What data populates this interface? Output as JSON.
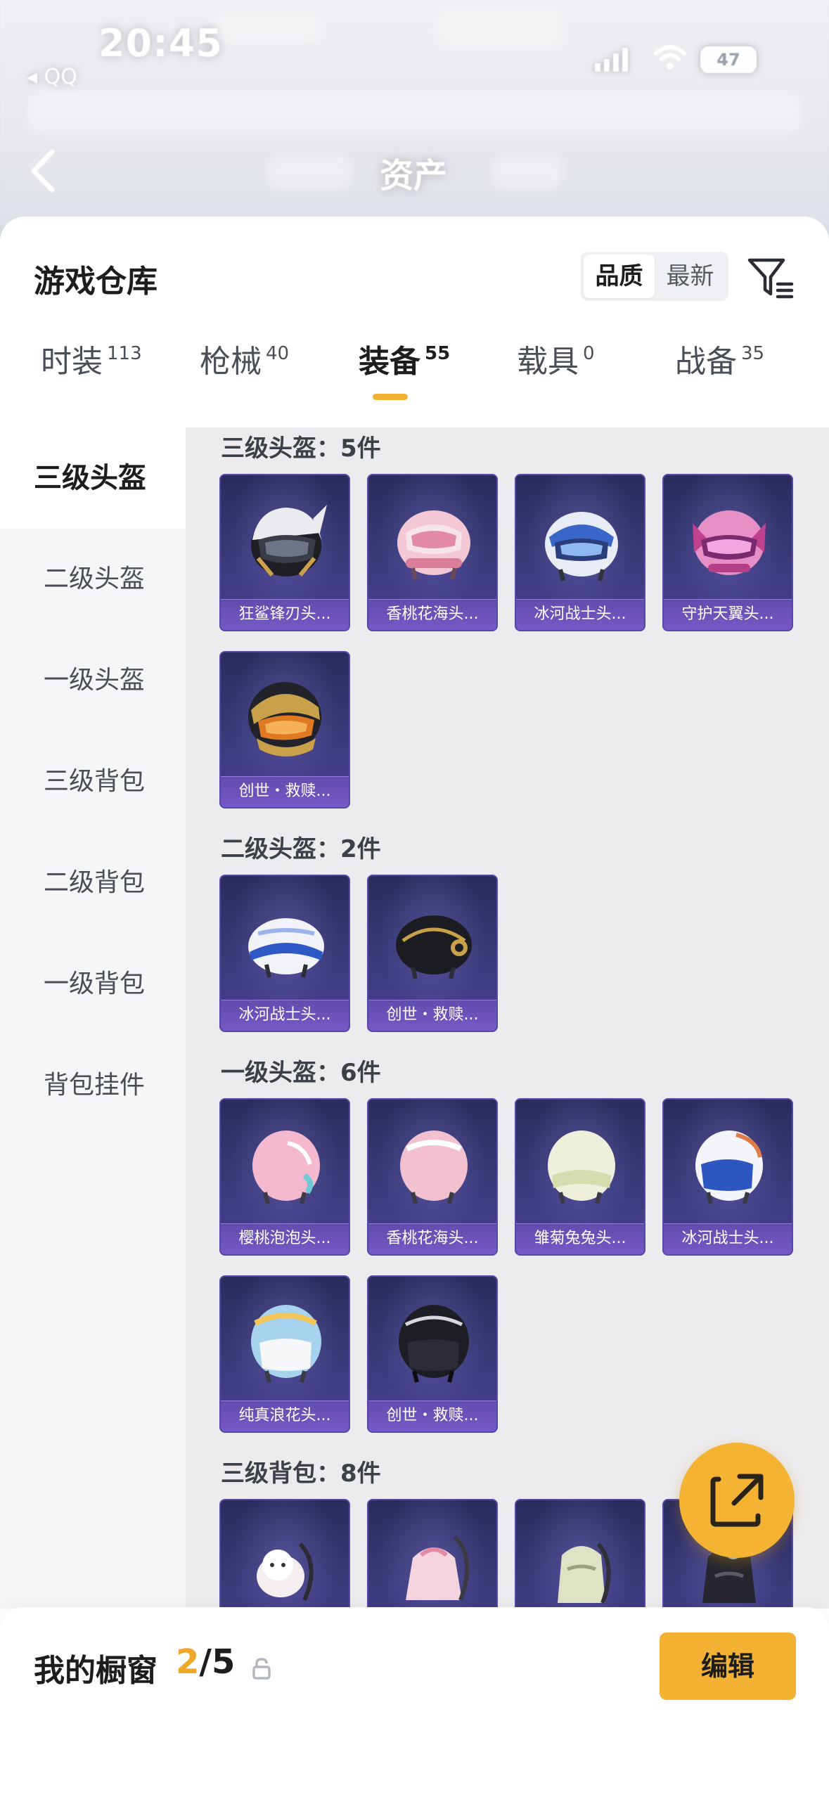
{
  "status_bar": {
    "time": "20:45",
    "back_app": "◂ QQ",
    "battery": "47"
  },
  "nav": {
    "title": "资产"
  },
  "header": {
    "title": "游戏仓库",
    "sort_options": [
      "品质",
      "最新"
    ],
    "active_sort": "品质"
  },
  "tabs": [
    {
      "label": "时装",
      "count": "113"
    },
    {
      "label": "枪械",
      "count": "40"
    },
    {
      "label": "装备",
      "count": "55"
    },
    {
      "label": "载具",
      "count": "0"
    },
    {
      "label": "战备",
      "count": "35"
    }
  ],
  "active_tab": "装备",
  "sidebar": {
    "items": [
      "三级头盔",
      "二级头盔",
      "一级头盔",
      "三级背包",
      "二级背包",
      "一级背包",
      "背包挂件"
    ],
    "active": "三级头盔"
  },
  "sections": [
    {
      "title": "三级头盔：5件",
      "items": [
        "狂鲨锋刃头...",
        "香桃花海头...",
        "冰河战士头...",
        "守护天翼头...",
        "创世・救赎..."
      ]
    },
    {
      "title": "二级头盔：2件",
      "items": [
        "冰河战士头...",
        "创世・救赎..."
      ]
    },
    {
      "title": "一级头盔：6件",
      "items": [
        "樱桃泡泡头...",
        "香桃花海头...",
        "雏菊兔兔头...",
        "冰河战士头...",
        "纯真浪花头...",
        "创世・救赎..."
      ]
    },
    {
      "title": "三级背包：8件",
      "items": [
        "",
        "",
        "",
        ""
      ]
    }
  ],
  "colors": {
    "accent": "#f3b234",
    "card_bg": "#3a3a7a",
    "card_label": "#7a5ad0"
  },
  "bottom_bar": {
    "label": "我的橱窗",
    "current": "2",
    "total": "/5",
    "edit_label": "编辑"
  }
}
